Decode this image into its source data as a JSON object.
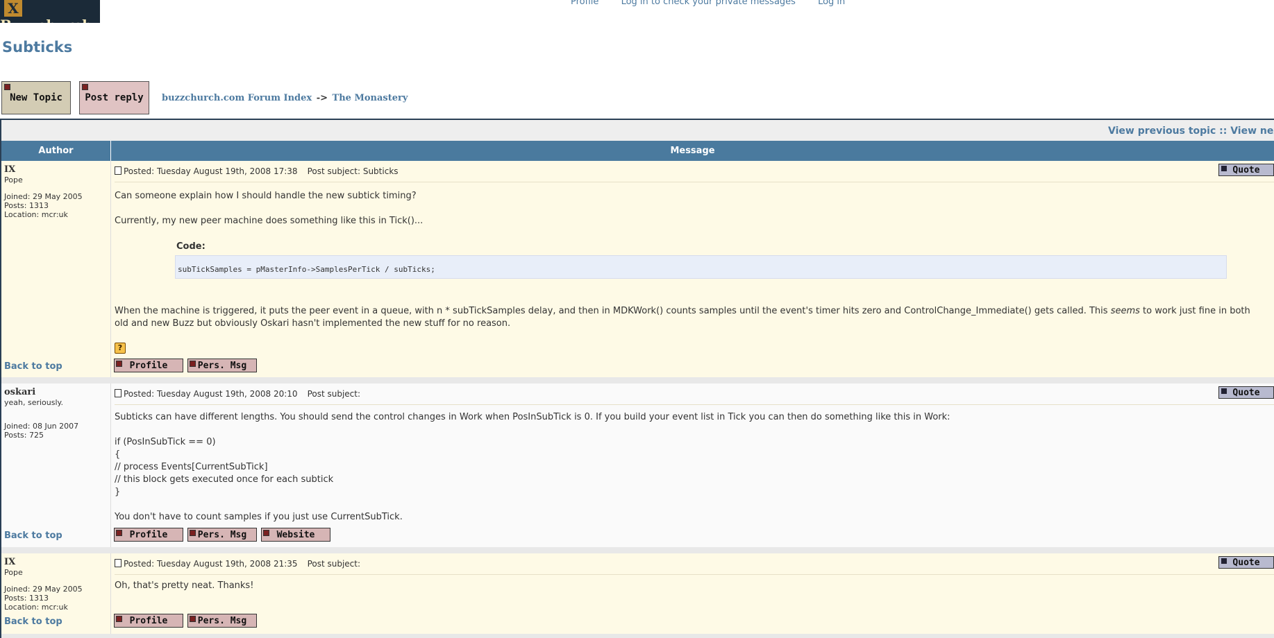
{
  "header": {
    "logo_text": "Buzzchurch",
    "nav": [
      "Profile",
      "Log in to check your private messages",
      "Log in"
    ]
  },
  "page_title": "Subticks",
  "actions": {
    "new_topic": "New Topic",
    "post_reply": "Post reply"
  },
  "breadcrumb": {
    "index": "buzzchurch.com Forum Index",
    "sep": "->",
    "forum": "The Monastery"
  },
  "topic_nav": {
    "prev": "View previous topic",
    "sep": "::",
    "next": "View next topic"
  },
  "table_headers": {
    "author": "Author",
    "message": "Message"
  },
  "labels": {
    "quote": "Quote",
    "back_to_top": "Back to top",
    "profile": "Profile",
    "pers_msg": "Pers. Msg",
    "website": "Website"
  },
  "posts": [
    {
      "author": "IX",
      "rank": "Pope",
      "joined": "Joined: 29 May 2005",
      "posts": "Posts: 1313",
      "location": "Location: mcr:uk",
      "posted": "Posted: Tuesday August 19th, 2008 17:38",
      "subject": "Post subject: Subticks",
      "line1": "Can someone explain how I should handle the new subtick timing?",
      "line2": "Currently, my new peer machine does something like this in Tick()...",
      "code_label": "Code:",
      "code": "subTickSamples = pMasterInfo->SamplesPerTick / subTicks;",
      "line3_a": "When the machine is triggered, it puts the peer event in a queue, with n * subTickSamples delay, and then in MDKWork() counts samples until the event's timer hits zero and ControlChange_Immediate() gets called. This ",
      "line3_em": "seems",
      "line3_b": " to work just fine in both",
      "line4": "old and new Buzz but obviously Oskari hasn't implemented the new stuff for no reason."
    },
    {
      "author": "oskari",
      "rank": "yeah, seriously.",
      "joined": "Joined: 08 Jun 2007",
      "posts": "Posts: 725",
      "posted": "Posted: Tuesday August 19th, 2008 20:10",
      "subject": "Post subject:",
      "lines": [
        "Subticks can have different lengths. You should send the control changes in Work when PosInSubTick is 0. If you build your event list in Tick you can then do something like this in Work:",
        "if (PosInSubTick == 0)",
        "{",
        "// process Events[CurrentSubTick]",
        "// this block gets executed once for each subtick",
        "}",
        "You don't have to count samples if you just use CurrentSubTick."
      ]
    },
    {
      "author": "IX",
      "rank": "Pope",
      "joined": "Joined: 29 May 2005",
      "posts": "Posts: 1313",
      "location": "Location: mcr:uk",
      "posted": "Posted: Tuesday August 19th, 2008 21:35",
      "subject": "Post subject:",
      "line1": "Oh, that's pretty neat. Thanks!"
    }
  ]
}
